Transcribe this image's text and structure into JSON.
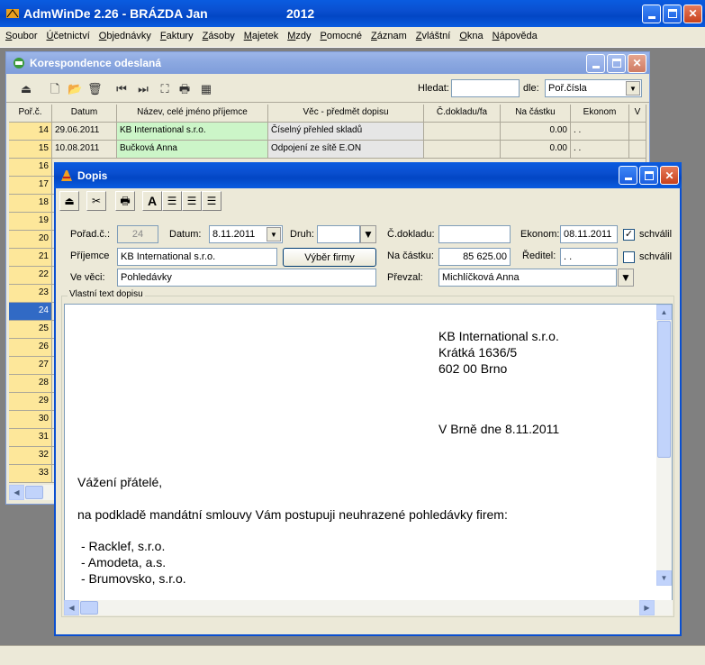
{
  "app": {
    "title": "AdmWinDe 2.26 - BRÁZDA Jan",
    "year": "2012"
  },
  "menu": [
    "Soubor",
    "Účetnictví",
    "Objednávky",
    "Faktury",
    "Zásoby",
    "Majetek",
    "Mzdy",
    "Pomocné",
    "Záznam",
    "Zvláštní",
    "Okna",
    "Nápověda"
  ],
  "korespondence": {
    "title": "Korespondence odeslaná",
    "search_label": "Hledat:",
    "search_value": "",
    "by_label": "dle:",
    "by_value": "Poř.čísla",
    "columns": [
      "Poř.č.",
      "Datum",
      "Název, celé jméno příjemce",
      "Věc - předmět dopisu",
      "Č.dokladu/fa",
      "Na částku",
      "Ekonom",
      "V"
    ],
    "rows": [
      {
        "num": "14",
        "date": "29.06.2011",
        "name": "KB International s.r.o.",
        "subject": "Číselný přehled skladů",
        "doc": "",
        "amount": "0.00",
        "ekonom": " .  ."
      },
      {
        "num": "15",
        "date": "10.08.2011",
        "name": "Bučková Anna",
        "subject": "Odpojení ze sítě E.ON",
        "doc": "",
        "amount": "0.00",
        "ekonom": " .  ."
      }
    ],
    "row_numbers": [
      "16",
      "17",
      "18",
      "19",
      "20",
      "21",
      "22",
      "23",
      "24",
      "25",
      "26",
      "27",
      "28",
      "29",
      "30",
      "31",
      "32",
      "33"
    ],
    "selected_row": "24"
  },
  "dopis": {
    "title": "Dopis",
    "porad_label": "Pořad.č.:",
    "porad_value": "24",
    "datum_label": "Datum:",
    "datum_value": "8.11.2011",
    "druh_label": "Druh:",
    "druh_value": "",
    "cdokladu_label": "Č.dokladu:",
    "cdokladu_value": "",
    "ekonom_label": "Ekonom:",
    "ekonom_value": "08.11.2011",
    "schvalil_label": "schválil",
    "prijemce_label": "Příjemce",
    "prijemce_value": "KB International s.r.o.",
    "vyber_firmy": "Výběr firmy",
    "nacastku_label": "Na částku:",
    "nacastku_value": "85 625.00",
    "reditel_label": "Ředitel:",
    "reditel_value": " .  .",
    "schvalil2_label": "schválil",
    "vevecí_label": "Ve věci:",
    "vevecí_value": "Pohledávky",
    "prevzal_label": "Převzal:",
    "prevzal_value": "Michlíčková Anna",
    "text_group_label": "Vlastní text dopisu",
    "letter": {
      "addr1": "KB International s.r.o.",
      "addr2": "Krátká 1636/5",
      "addr3": "602 00  Brno",
      "place_date": "V Brně dne 8.11.2011",
      "greeting": "Vážení přátelé,",
      "body": "na podkladě mandátní smlouvy Vám postupuji neuhrazené pohledávky firem:",
      "item1": "- Racklef, s.r.o.",
      "item2": "- Amodeta, a.s.",
      "item3": "- Brumovsko, s.r.o."
    }
  }
}
